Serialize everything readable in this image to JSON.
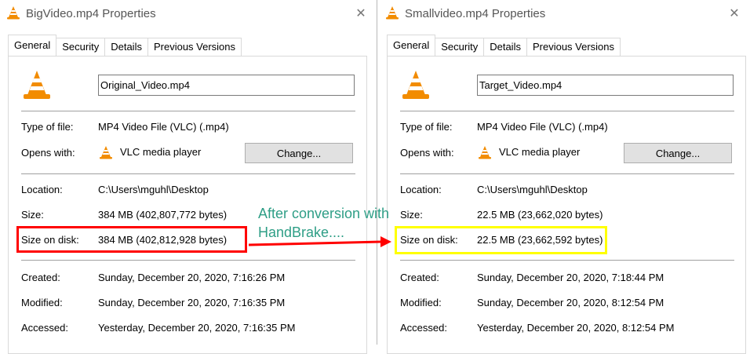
{
  "left": {
    "title": "BigVideo.mp4 Properties",
    "tabs": [
      "General",
      "Security",
      "Details",
      "Previous Versions"
    ],
    "file_name": "Original_Video.mp4",
    "type_label": "Type of file:",
    "type_value": "MP4 Video File (VLC) (.mp4)",
    "opens_label": "Opens with:",
    "opens_value": "VLC media player",
    "change_label": "Change...",
    "location_label": "Location:",
    "location_value": "C:\\Users\\mguhl\\Desktop",
    "size_label": "Size:",
    "size_value": "384 MB (402,807,772 bytes)",
    "size_on_disk_label": "Size on disk:",
    "size_on_disk_value": "384 MB (402,812,928 bytes)",
    "created_label": "Created:",
    "created_value": "Sunday, December 20, 2020, 7:16:26 PM",
    "modified_label": "Modified:",
    "modified_value": "Sunday, December 20, 2020, 7:16:35 PM",
    "accessed_label": "Accessed:",
    "accessed_value": "Yesterday, December 20, 2020, 7:16:35 PM"
  },
  "right": {
    "title": "Smallvideo.mp4 Properties",
    "tabs": [
      "General",
      "Security",
      "Details",
      "Previous Versions"
    ],
    "file_name": "Target_Video.mp4",
    "type_label": "Type of file:",
    "type_value": "MP4 Video File (VLC) (.mp4)",
    "opens_label": "Opens with:",
    "opens_value": "VLC media player",
    "change_label": "Change...",
    "location_label": "Location:",
    "location_value": "C:\\Users\\mguhl\\Desktop",
    "size_label": "Size:",
    "size_value": "22.5 MB (23,662,020 bytes)",
    "size_on_disk_label": "Size on disk:",
    "size_on_disk_value": "22.5 MB (23,662,592 bytes)",
    "created_label": "Created:",
    "created_value": "Sunday, December 20, 2020, 7:18:44 PM",
    "modified_label": "Modified:",
    "modified_value": "Sunday, December 20, 2020, 8:12:54 PM",
    "accessed_label": "Accessed:",
    "accessed_value": "Yesterday, December 20, 2020, 8:12:54 PM"
  },
  "annotation": {
    "line1": "After conversion with",
    "line2": "HandBrake....",
    "text_color": "#2e9e86",
    "arrow_color": "#ff0000",
    "left_highlight_color": "#ff0000",
    "right_highlight_color": "#ffff00"
  },
  "colors": {
    "vlc_orange": "#f28c00",
    "cone_stripe": "#ffffff",
    "button_bg": "#e1e1e1"
  },
  "icons": {
    "app": "vlc-cone-icon",
    "close": "close-icon"
  }
}
